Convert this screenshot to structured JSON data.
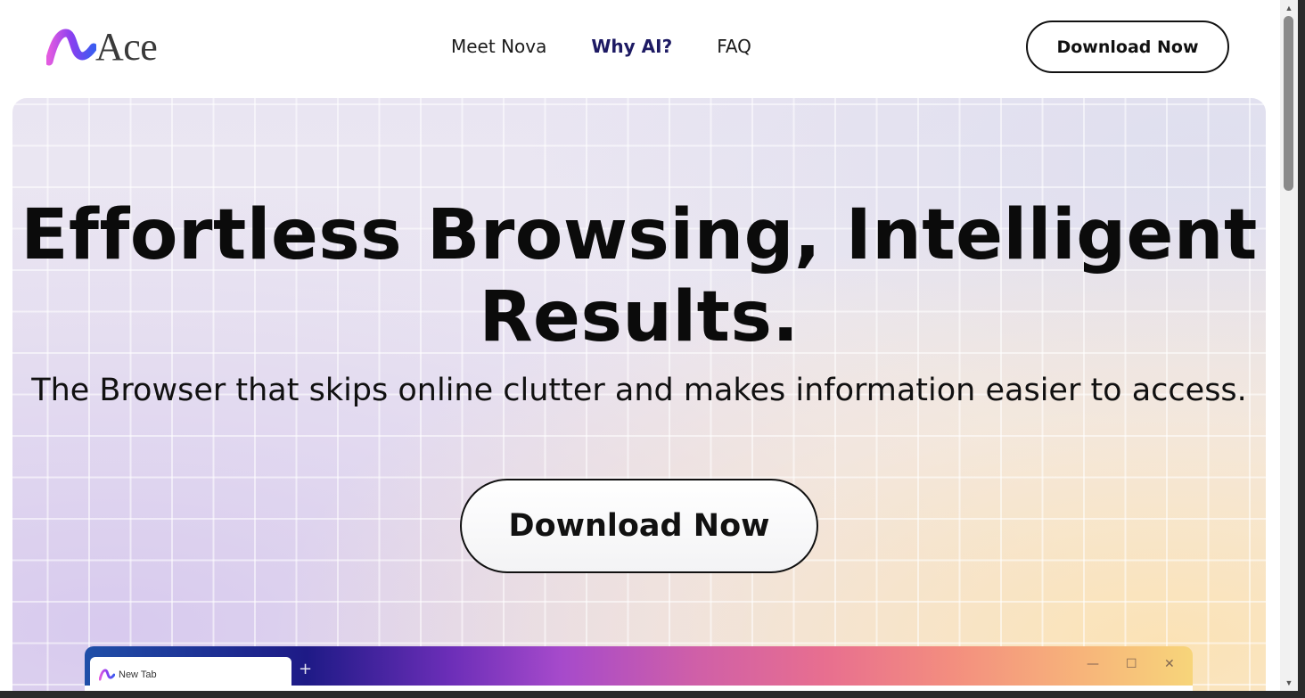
{
  "header": {
    "logo_text": "Ace",
    "nav": [
      {
        "label": "Meet Nova",
        "active": false
      },
      {
        "label": "Why AI?",
        "active": true
      },
      {
        "label": "FAQ",
        "active": false
      }
    ],
    "download_label": "Download Now"
  },
  "hero": {
    "title_line1": "Effortless Browsing, Intelligent",
    "title_line2": "Results.",
    "subtitle": "The Browser that skips online clutter and makes information easier to access.",
    "download_label": "Download Now"
  },
  "mockup": {
    "tab_label": "New Tab",
    "new_tab_symbol": "+",
    "minimize_symbol": "—",
    "maximize_symbol": "☐",
    "close_symbol": "✕"
  },
  "scrollbar": {
    "up_symbol": "▲",
    "down_symbol": "▼"
  },
  "colors": {
    "nav_active": "#1d1a63",
    "text": "#0b0b0b",
    "logo_gradient": [
      "#7a3cf0",
      "#d94fd0",
      "#3b6cf2"
    ]
  }
}
